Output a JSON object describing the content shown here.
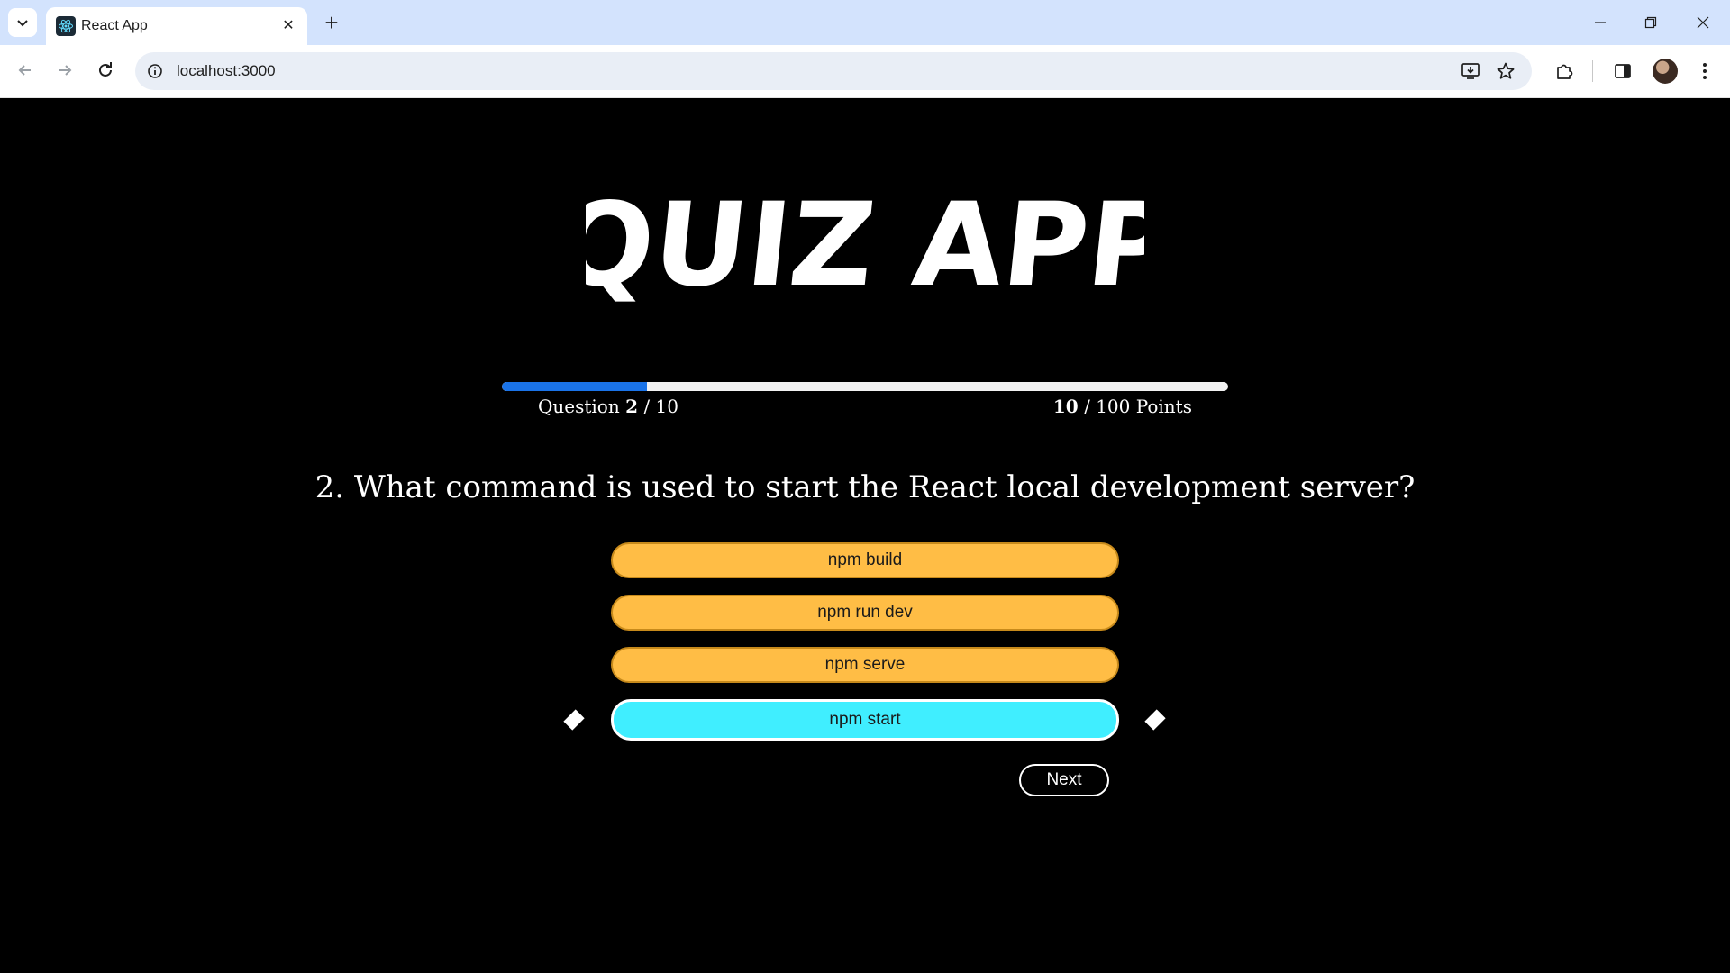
{
  "browser": {
    "tab_title": "React App",
    "url": "localhost:3000"
  },
  "logo": {
    "text": "QUIZ APP"
  },
  "progress": {
    "value": 0.2,
    "question_label": "Question",
    "current_question": "2",
    "total_questions": "/ 10",
    "score": "10",
    "points_label": "/ 100 Points"
  },
  "question": {
    "text": "2. What command is used to start the React local development server?"
  },
  "options": [
    {
      "label": "npm build",
      "selected": false
    },
    {
      "label": "npm run dev",
      "selected": false
    },
    {
      "label": "npm serve",
      "selected": false
    },
    {
      "label": "npm start",
      "selected": true
    }
  ],
  "next_label": "Next",
  "colors": {
    "background": "#000000",
    "option": "#ffbd45",
    "option_selected": "#40eeff",
    "progress_fill": "#1a73e8",
    "progress_track": "#f2f2f2",
    "tabstrip": "#d3e3fd"
  }
}
